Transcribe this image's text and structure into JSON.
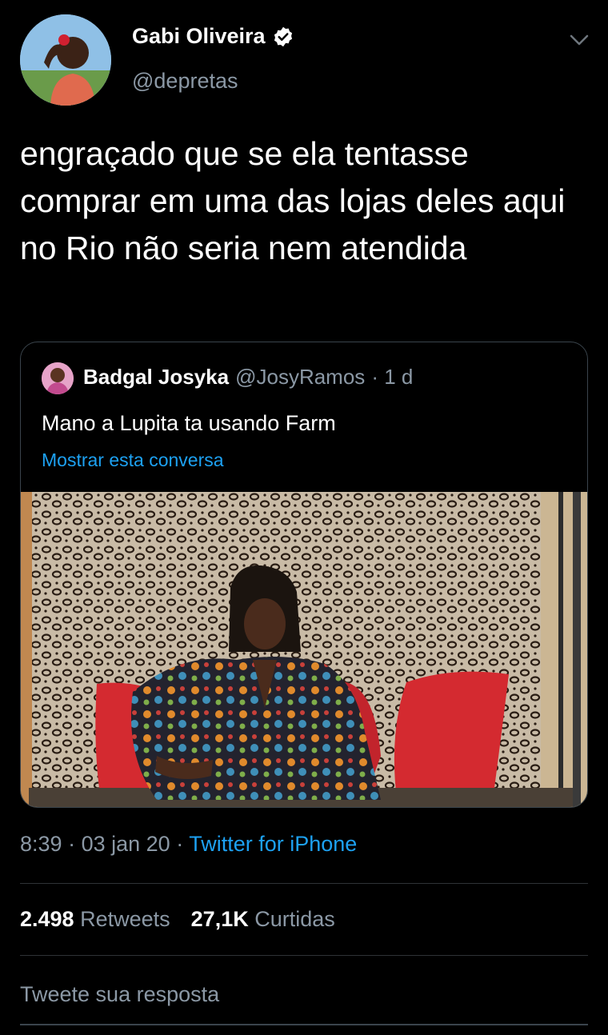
{
  "tweet": {
    "author_name": "Gabi Oliveira",
    "author_handle": "@depretas",
    "text": "engraçado que se ela tentasse comprar em uma das lojas deles aqui no Rio não seria nem atendida",
    "time": "8:39",
    "date": "03 jan 20",
    "source": "Twitter for iPhone"
  },
  "quote": {
    "author_name": "Badgal Josyka",
    "author_handle": "@JosyRamos",
    "age": "· 1 d",
    "text": "Mano a Lupita ta usando Farm",
    "show_thread": "Mostrar esta conversa"
  },
  "stats": {
    "retweets_count": "2.498",
    "retweets_label": "Retweets",
    "likes_count": "27,1K",
    "likes_label": "Curtidas"
  },
  "reply": {
    "placeholder": "Tweete sua resposta"
  },
  "colors": {
    "link": "#1da1f2",
    "secondary": "#8b98a5",
    "background": "#000000"
  },
  "icons": [
    "verified-badge-icon",
    "chevron-down-icon"
  ]
}
